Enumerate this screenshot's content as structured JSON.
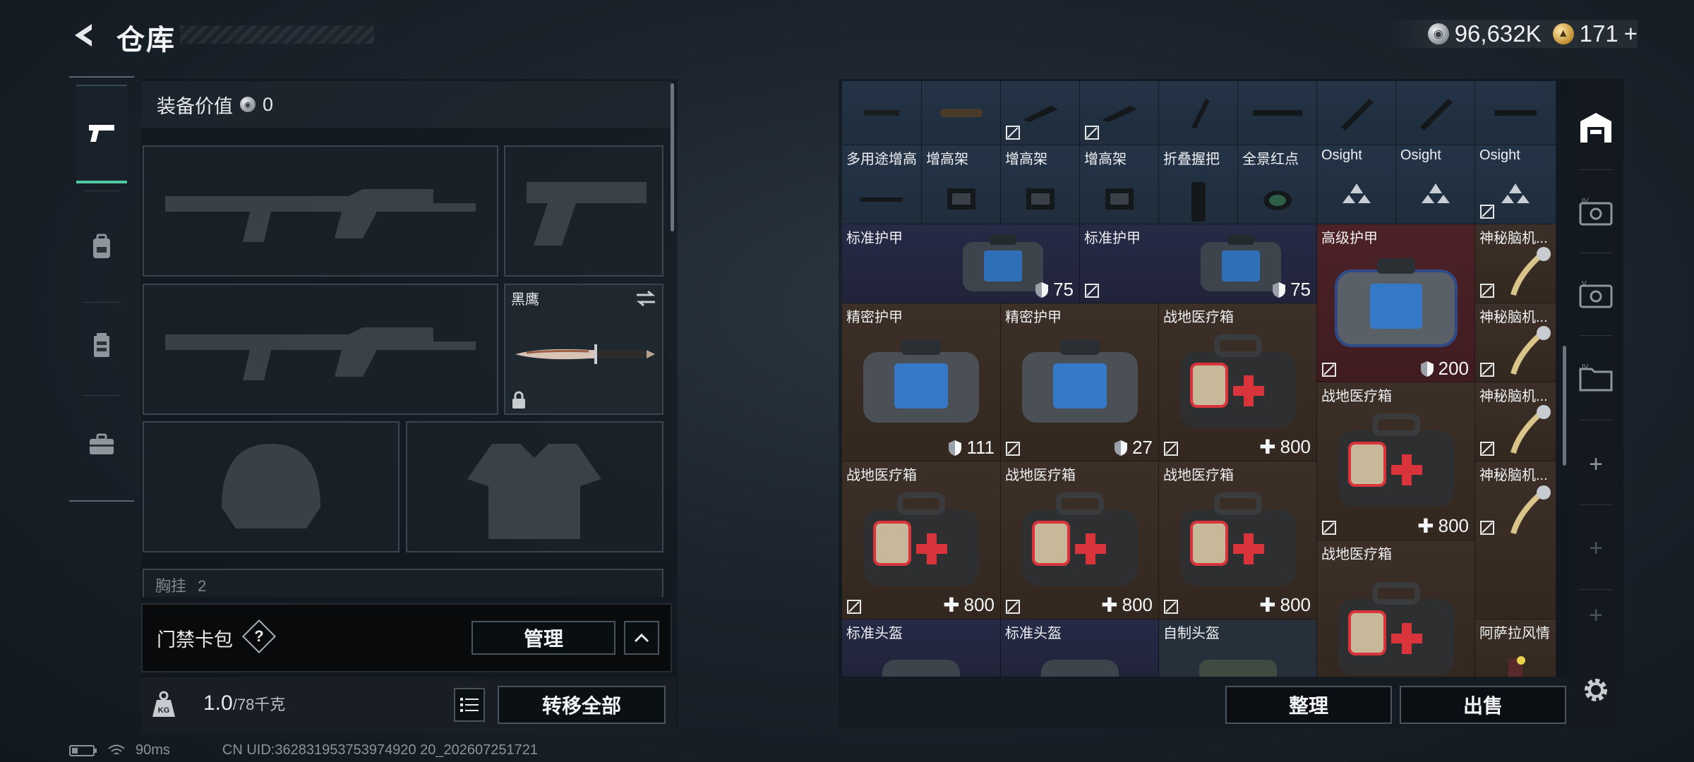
{
  "header": {
    "title": "仓库",
    "currency_silver": "96,632K",
    "currency_gold": "171",
    "currency_gold_plus": "+"
  },
  "loadout": {
    "equip_value_label": "装备价值",
    "equip_value": "0",
    "knife_name": "黑鹰",
    "chest_label": "胸挂",
    "chest_count": "2",
    "card_bag_label": "门禁卡包",
    "card_help": "?",
    "manage_label": "管理",
    "weight_current": "1.0",
    "weight_max": "/78千克",
    "weight_icon_label": "KG",
    "transfer_all_label": "转移全部"
  },
  "inventory": {
    "row0": [
      "",
      "",
      "",
      "",
      "",
      "",
      "",
      "",
      ""
    ],
    "row1": [
      "多用途增高",
      "增高架",
      "增高架",
      "增高架",
      "折叠握把",
      "全景红点",
      "Osight",
      "Osight",
      "Osight"
    ],
    "items": [
      {
        "name": "标准护甲",
        "value": "75"
      },
      {
        "name": "标准护甲",
        "value": "75"
      },
      {
        "name": "高级护甲",
        "value": "200"
      },
      {
        "name": "神秘脑机...",
        "value": ""
      },
      {
        "name": "精密护甲",
        "value": "111"
      },
      {
        "name": "精密护甲",
        "value": "27"
      },
      {
        "name": "战地医疗箱",
        "value": "800"
      },
      {
        "name": "神秘脑机...",
        "value": ""
      },
      {
        "name": "战地医疗箱",
        "value": "800"
      },
      {
        "name": "神秘脑机...",
        "value": ""
      },
      {
        "name": "战地医疗箱",
        "value": "800"
      },
      {
        "name": "战地医疗箱",
        "value": "800"
      },
      {
        "name": "战地医疗箱",
        "value": "800"
      },
      {
        "name": "战地医疗箱",
        "value": ""
      },
      {
        "name": "神秘脑机...",
        "value": ""
      },
      {
        "name": "标准头盔",
        "value": ""
      },
      {
        "name": "标准头盔",
        "value": ""
      },
      {
        "name": "自制头盔",
        "value": ""
      },
      {
        "name": "阿萨拉风情",
        "value": ""
      }
    ],
    "sort_label": "整理",
    "sell_label": "出售"
  },
  "status": {
    "ping": "90ms",
    "uid": "CN UID:362831953753974920 20_202607251721"
  },
  "colors": {
    "accent_green": "#4fc9a0",
    "cell_blue": "#243447",
    "cell_purple": "#262a45",
    "cell_brown": "#3c2f28",
    "cell_red": "#4d2227"
  }
}
